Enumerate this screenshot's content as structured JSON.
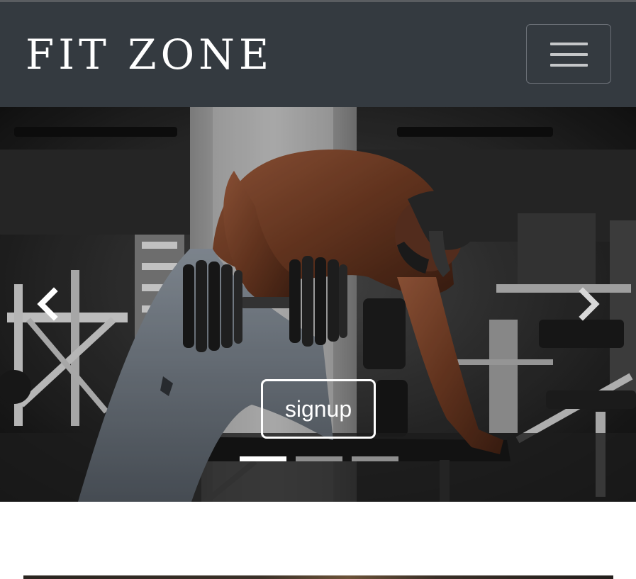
{
  "navbar": {
    "brand": "FIT ZONE",
    "toggler_icon": "hamburger-menu-icon",
    "background": "#343a40"
  },
  "carousel": {
    "prev_icon": "chevron-left-icon",
    "next_icon": "chevron-right-icon",
    "cta_label": "signup",
    "active_slide": 1,
    "slide_count": 3,
    "slide_image": "gym-athlete-dumbbell-row-photo"
  }
}
